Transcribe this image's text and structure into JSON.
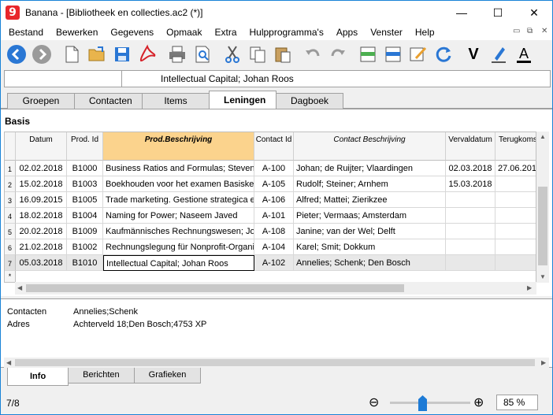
{
  "window": {
    "title": "Banana - [Bibliotheek en collecties.ac2 (*)]",
    "logo_glyph": "9",
    "min_glyph": "—",
    "max_glyph": "☐",
    "close_glyph": "✕"
  },
  "menu": [
    "Bestand",
    "Bewerken",
    "Gegevens",
    "Opmaak",
    "Extra",
    "Hulpprogramma's",
    "Apps",
    "Venster",
    "Help"
  ],
  "mdi": {
    "min": "▭",
    "restore": "⧉",
    "close": "✕"
  },
  "toolbar": {
    "icons": [
      "back-arrow-icon",
      "forward-arrow-icon",
      "new-file-icon",
      "open-folder-icon",
      "save-icon",
      "pdf-icon",
      "print-icon",
      "print-preview-icon",
      "cut-icon",
      "copy-icon",
      "paste-icon",
      "undo-icon",
      "redo-icon",
      "insert-rows-icon",
      "delete-rows-icon",
      "edit-icon",
      "recalculate-icon",
      "bold-icon",
      "highlight-icon",
      "font-color-icon"
    ],
    "bold_glyph": "V",
    "font_glyph": "A"
  },
  "cellbar": {
    "content": "Intellectual Capital; Johan Roos"
  },
  "tabs": [
    "Groepen",
    "Contacten",
    "Items",
    "Leningen",
    "Dagboek"
  ],
  "active_tab": "Leningen",
  "section": "Basis",
  "table": {
    "columns": [
      "Datum",
      "Prod. Id",
      "Prod.Beschrijving",
      "Contact Id",
      "Contact Beschrijving",
      "Vervaldatum",
      "Terugkomst"
    ],
    "rows": [
      {
        "num": "1",
        "cells": [
          "02.02.2018",
          "B1000",
          "Business Ratios and Formulas; Steven",
          "A-100",
          "Johan; de Ruijter; Vlaardingen",
          "02.03.2018",
          "27.06.2018"
        ]
      },
      {
        "num": "2",
        "cells": [
          "15.02.2018",
          "B1003",
          "Boekhouden voor het examen Basisker",
          "A-105",
          "Rudolf; Steiner; Arnhem",
          "15.03.2018",
          ""
        ]
      },
      {
        "num": "3",
        "cells": [
          "16.09.2015",
          "B1005",
          "Trade marketing. Gestione strategica e",
          "A-106",
          "Alfred; Mattei; Zierikzee",
          "",
          ""
        ]
      },
      {
        "num": "4",
        "cells": [
          "18.02.2018",
          "B1004",
          "Naming for Power; Naseem Javed",
          "A-101",
          "Pieter; Vermaas; Amsterdam",
          "",
          ""
        ]
      },
      {
        "num": "5",
        "cells": [
          "20.02.2018",
          "B1009",
          "Kaufmännisches Rechnungswesen; Jo",
          "A-108",
          "Janine; van der Wel; Delft",
          "",
          ""
        ]
      },
      {
        "num": "6",
        "cells": [
          "21.02.2018",
          "B1002",
          "Rechnungslegung für Nonprofit-Organi",
          "A-104",
          "Karel; Smit; Dokkum",
          "",
          ""
        ]
      },
      {
        "num": "7",
        "cells": [
          "05.03.2018",
          "B1010",
          "Intellectual Capital; Johan Roos",
          "A-102",
          "Annelies; Schenk; Den Bosch",
          "",
          ""
        ]
      }
    ],
    "new_row_marker": "*"
  },
  "info": {
    "contacten_label": "Contacten",
    "contacten_value": "Annelies;Schenk",
    "adres_label": "Adres",
    "adres_value": "Achterveld 18;Den Bosch;4753 XP"
  },
  "bottom_tabs": [
    "Info",
    "Berichten",
    "Grafieken"
  ],
  "status": {
    "position": "7/8",
    "zoom_out": "⊖",
    "zoom_in": "⊕",
    "zoom": "85 %"
  },
  "colors": {
    "selected_header": "#fbd38d",
    "accent_blue": "#1e7bd6",
    "logo_red": "#e8262b"
  }
}
